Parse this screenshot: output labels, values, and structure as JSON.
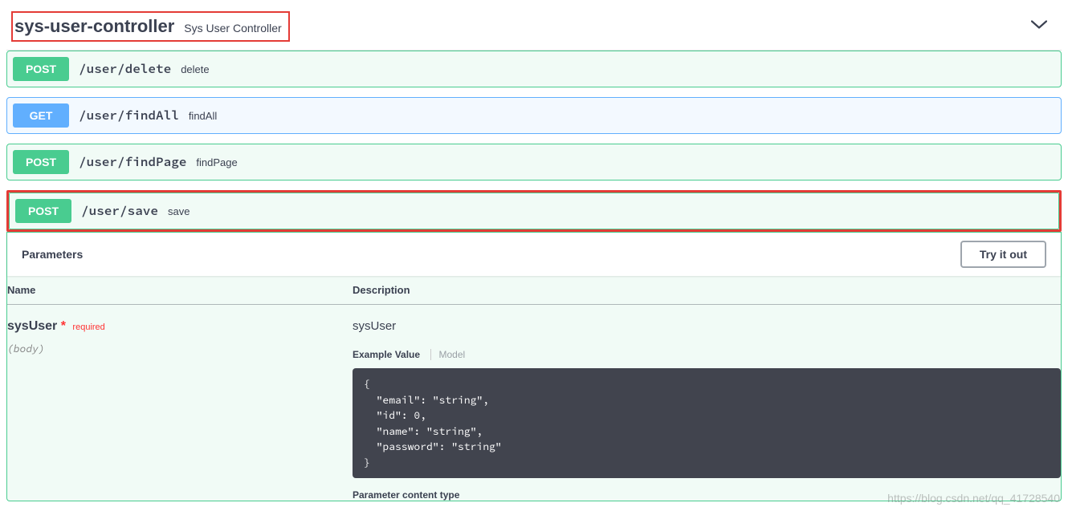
{
  "controller": {
    "name": "sys-user-controller",
    "description": "Sys User Controller"
  },
  "endpoints": [
    {
      "method": "POST",
      "path": "/user/delete",
      "summary": "delete"
    },
    {
      "method": "GET",
      "path": "/user/findAll",
      "summary": "findAll"
    },
    {
      "method": "POST",
      "path": "/user/findPage",
      "summary": "findPage"
    },
    {
      "method": "POST",
      "path": "/user/save",
      "summary": "save"
    }
  ],
  "parameters": {
    "section_title": "Parameters",
    "try_it_out": "Try it out",
    "headers": {
      "name": "Name",
      "description": "Description"
    },
    "rows": [
      {
        "name": "sysUser",
        "required_label": "required",
        "in": "(body)",
        "description": "sysUser",
        "tabs": {
          "example": "Example Value",
          "model": "Model"
        },
        "example_json": "{\n  \"email\": \"string\",\n  \"id\": 0,\n  \"name\": \"string\",\n  \"password\": \"string\"\n}",
        "content_type_label": "Parameter content type"
      }
    ]
  },
  "watermark": "https://blog.csdn.net/qq_41728540"
}
